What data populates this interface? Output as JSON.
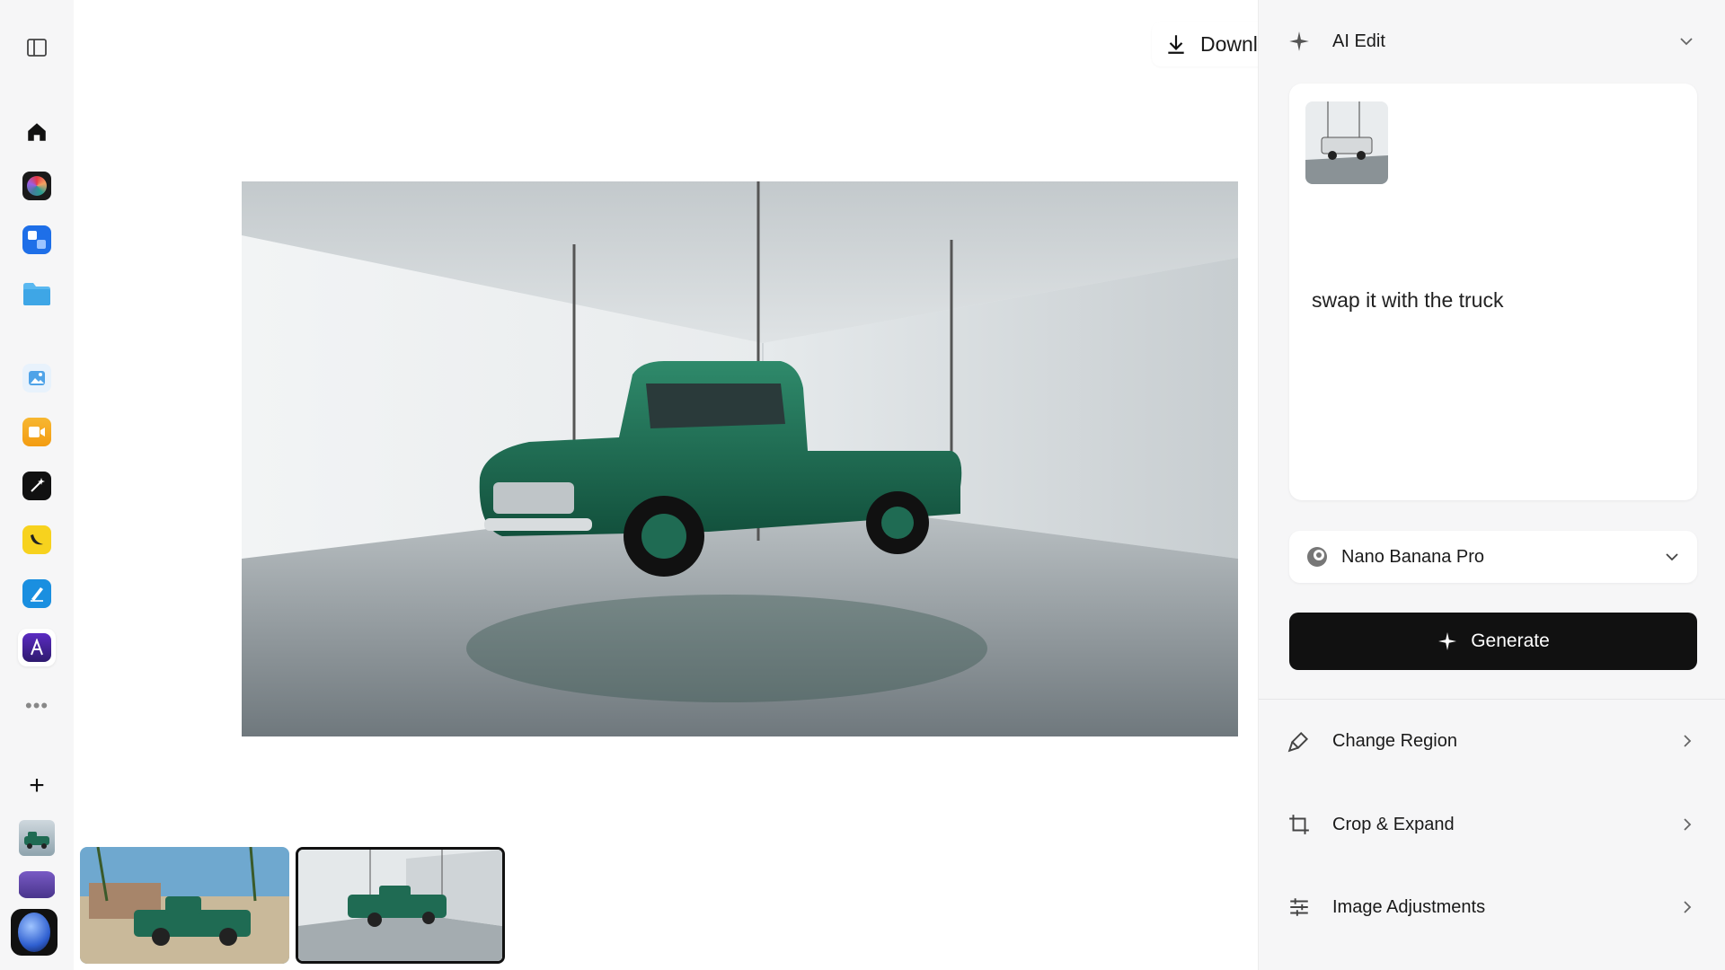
{
  "canvas": {
    "download_label": "Download"
  },
  "rail": {
    "apps": [
      "home-icon",
      "color-wheel-app",
      "blocks-app",
      "folder-app",
      "photos-app",
      "video-app",
      "magic-wand-app",
      "banana-app",
      "pen-app",
      "font-app"
    ],
    "more_label": "•••",
    "add_label": "+"
  },
  "panel": {
    "title": "AI Edit",
    "prompt": "swap it with the truck",
    "model": "Nano Banana Pro",
    "generate_label": "Generate",
    "tools": [
      {
        "label": "Change Region",
        "icon": "brush-icon"
      },
      {
        "label": "Crop & Expand",
        "icon": "crop-icon"
      },
      {
        "label": "Image Adjustments",
        "icon": "sliders-icon"
      }
    ]
  },
  "colors": {
    "accent": "#111111",
    "truck_green": "#1f6b53"
  }
}
